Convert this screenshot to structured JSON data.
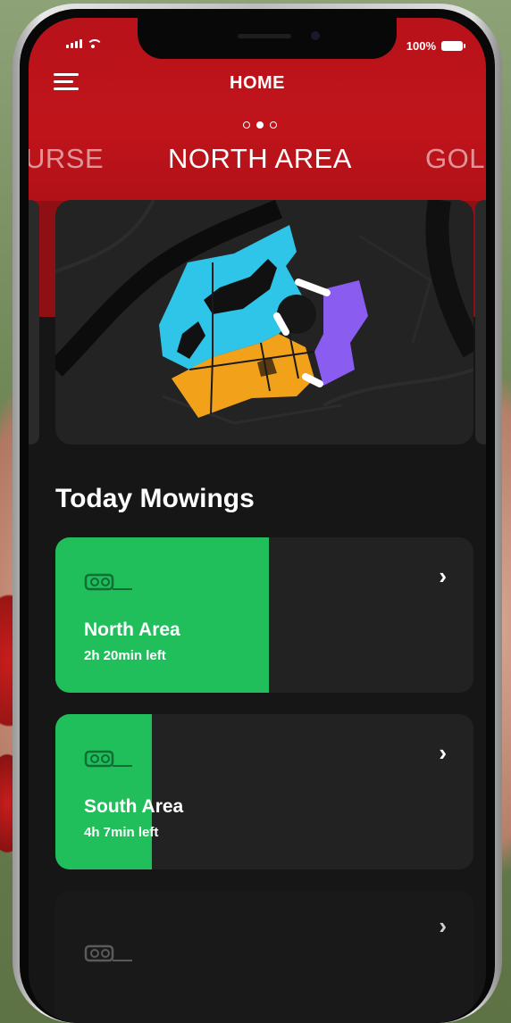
{
  "status": {
    "battery": "100%"
  },
  "header": {
    "title": "HOME",
    "pager": {
      "count": 3,
      "active": 1
    },
    "tabs": {
      "prev": "URSE",
      "current": "NORTH AREA",
      "next": "GOLI"
    }
  },
  "map": {
    "zones": [
      {
        "name": "cyan-zone",
        "color": "#2ec5e8"
      },
      {
        "name": "orange-zone",
        "color": "#f2a21a"
      },
      {
        "name": "purple-zone",
        "color": "#8a5cf0"
      }
    ]
  },
  "mowings": {
    "title": "Today Mowings",
    "items": [
      {
        "name": "North Area",
        "time": "2h 20min left",
        "progress": 0.51
      },
      {
        "name": "South Area",
        "time": "4h 7min left",
        "progress": 0.23
      },
      {
        "name": "",
        "time": "",
        "progress": 0
      }
    ]
  },
  "colors": {
    "header": "#c0141b",
    "progress": "#20bf5b",
    "card": "#222222",
    "background": "#161616"
  }
}
